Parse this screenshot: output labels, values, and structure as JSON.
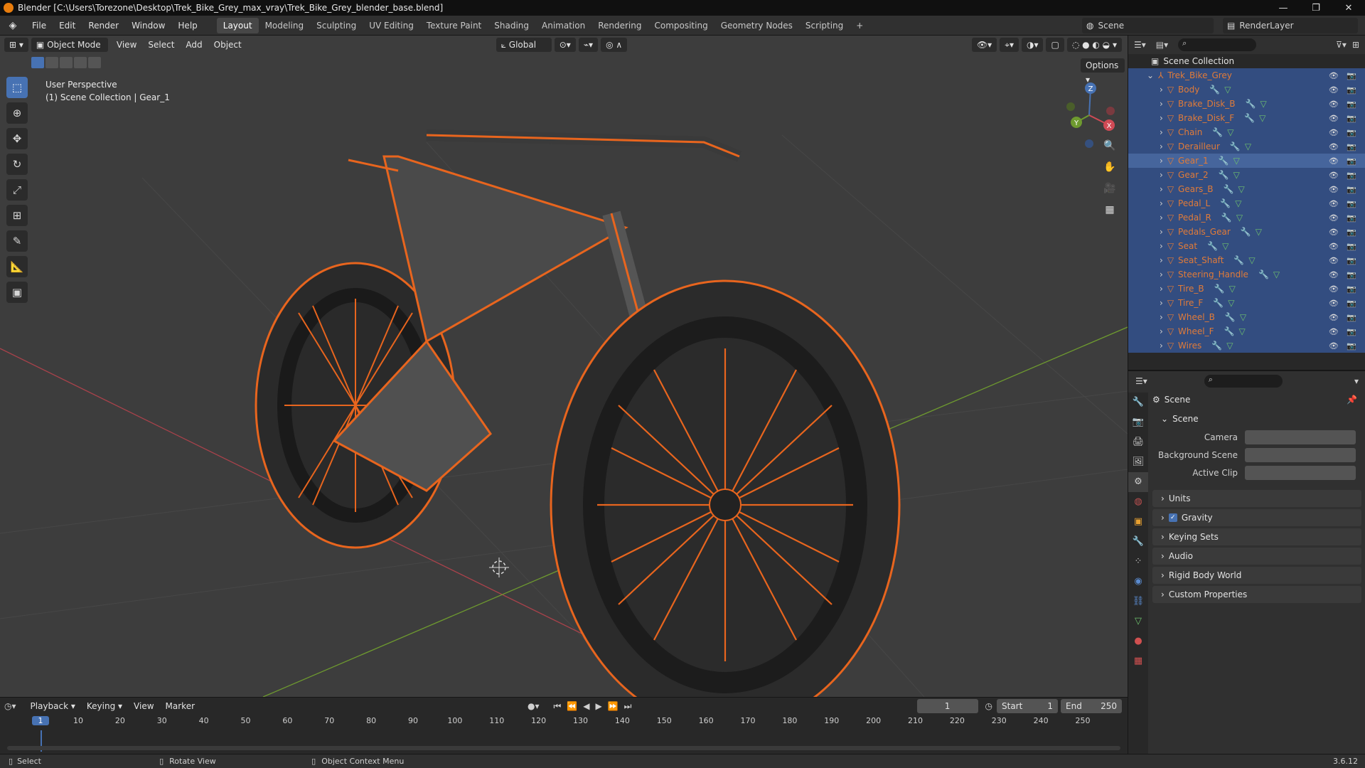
{
  "title_bar": {
    "title": "Blender [C:\\Users\\Torezone\\Desktop\\Trek_Bike_Grey_max_vray\\Trek_Bike_Grey_blender_base.blend]",
    "controls": [
      "—",
      "❐",
      "✕"
    ]
  },
  "menu": {
    "items": [
      "File",
      "Edit",
      "Render",
      "Window",
      "Help"
    ]
  },
  "workspace_tabs": [
    "Layout",
    "Modeling",
    "Sculpting",
    "UV Editing",
    "Texture Paint",
    "Shading",
    "Animation",
    "Rendering",
    "Compositing",
    "Geometry Nodes",
    "Scripting",
    "+"
  ],
  "active_workspace": "Layout",
  "scene_selector": "Scene",
  "render_layer": "RenderLayer",
  "viewport": {
    "mode": "Object Mode",
    "menus": [
      "View",
      "Select",
      "Add",
      "Object"
    ],
    "orientation": "Global",
    "options_label": "Options",
    "info_line1": "User Perspective",
    "info_line2": "(1) Scene Collection | Gear_1",
    "gizmo_labels": {
      "z": "Z",
      "x": "X",
      "y": "Y"
    }
  },
  "outliner": {
    "root": "Scene Collection",
    "collection": "Trek_Bike_Grey",
    "objects": [
      "Body",
      "Brake_Disk_B",
      "Brake_Disk_F",
      "Chain",
      "Derailleur",
      "Gear_1",
      "Gear_2",
      "Gears_B",
      "Pedal_L",
      "Pedal_R",
      "Pedals_Gear",
      "Seat",
      "Seat_Shaft",
      "Steering_Handle",
      "Tire_B",
      "Tire_F",
      "Wheel_B",
      "Wheel_F",
      "Wires"
    ],
    "active_object": "Gear_1"
  },
  "properties": {
    "header": "Scene",
    "panel": "Scene",
    "fields": [
      {
        "label": "Camera"
      },
      {
        "label": "Background Scene"
      },
      {
        "label": "Active Clip"
      }
    ],
    "sections": [
      "Units",
      "Gravity",
      "Keying Sets",
      "Audio",
      "Rigid Body World",
      "Custom Properties"
    ],
    "gravity_checked": true
  },
  "timeline": {
    "menus": [
      "Playback",
      "Keying",
      "View",
      "Marker"
    ],
    "current_frame": "1",
    "start_label": "Start",
    "start": "1",
    "end_label": "End",
    "end": "250",
    "ruler": [
      "1",
      "10",
      "20",
      "30",
      "40",
      "50",
      "60",
      "70",
      "80",
      "90",
      "100",
      "110",
      "120",
      "130",
      "140",
      "150",
      "160",
      "170",
      "180",
      "190",
      "200",
      "210",
      "220",
      "230",
      "240",
      "250"
    ]
  },
  "status_bar": {
    "select": "Select",
    "rotate": "Rotate View",
    "context": "Object Context Menu",
    "version": "3.6.12"
  },
  "colors": {
    "selection_orange": "#e8651e",
    "active_blue": "#4772b3",
    "viewport_bg": "#3d3d3d",
    "x_axis": "#a8424b",
    "y_axis": "#6e9a2f"
  }
}
